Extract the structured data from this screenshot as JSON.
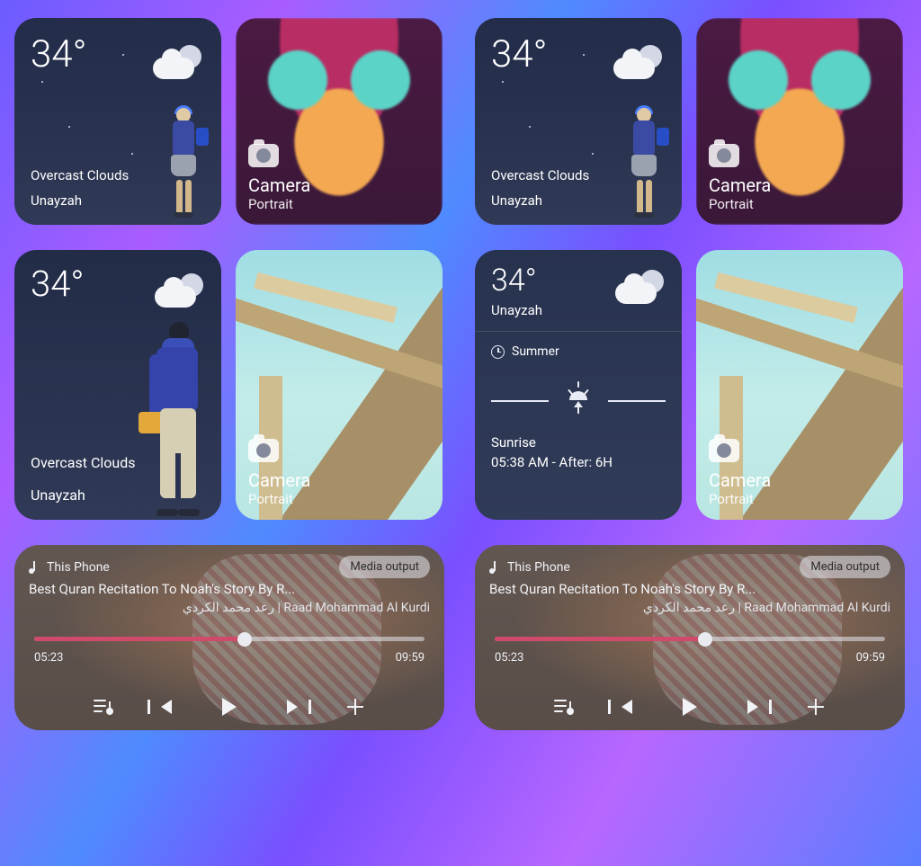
{
  "weather_small": {
    "temp": "34°",
    "condition": "Overcast Clouds",
    "location": "Unayzah"
  },
  "camera": {
    "title": "Camera",
    "mode": "Portrait"
  },
  "weather_tall": {
    "temp": "34°",
    "condition": "Overcast Clouds",
    "location": "Unayzah"
  },
  "weather_detail": {
    "temp": "34°",
    "location": "Unayzah",
    "season": "Summer",
    "sunrise_label": "Sunrise",
    "sunrise_time": "05:38 AM - After: 6H"
  },
  "media": {
    "device": "This Phone",
    "output_button": "Media output",
    "title": "Best Quran Recitation To Noah's Story By R...",
    "artist": "Raad Mohammad Al Kurdi | رعد محمد الكردي",
    "elapsed": "05:23",
    "duration": "09:59",
    "progress_percent": 54
  }
}
